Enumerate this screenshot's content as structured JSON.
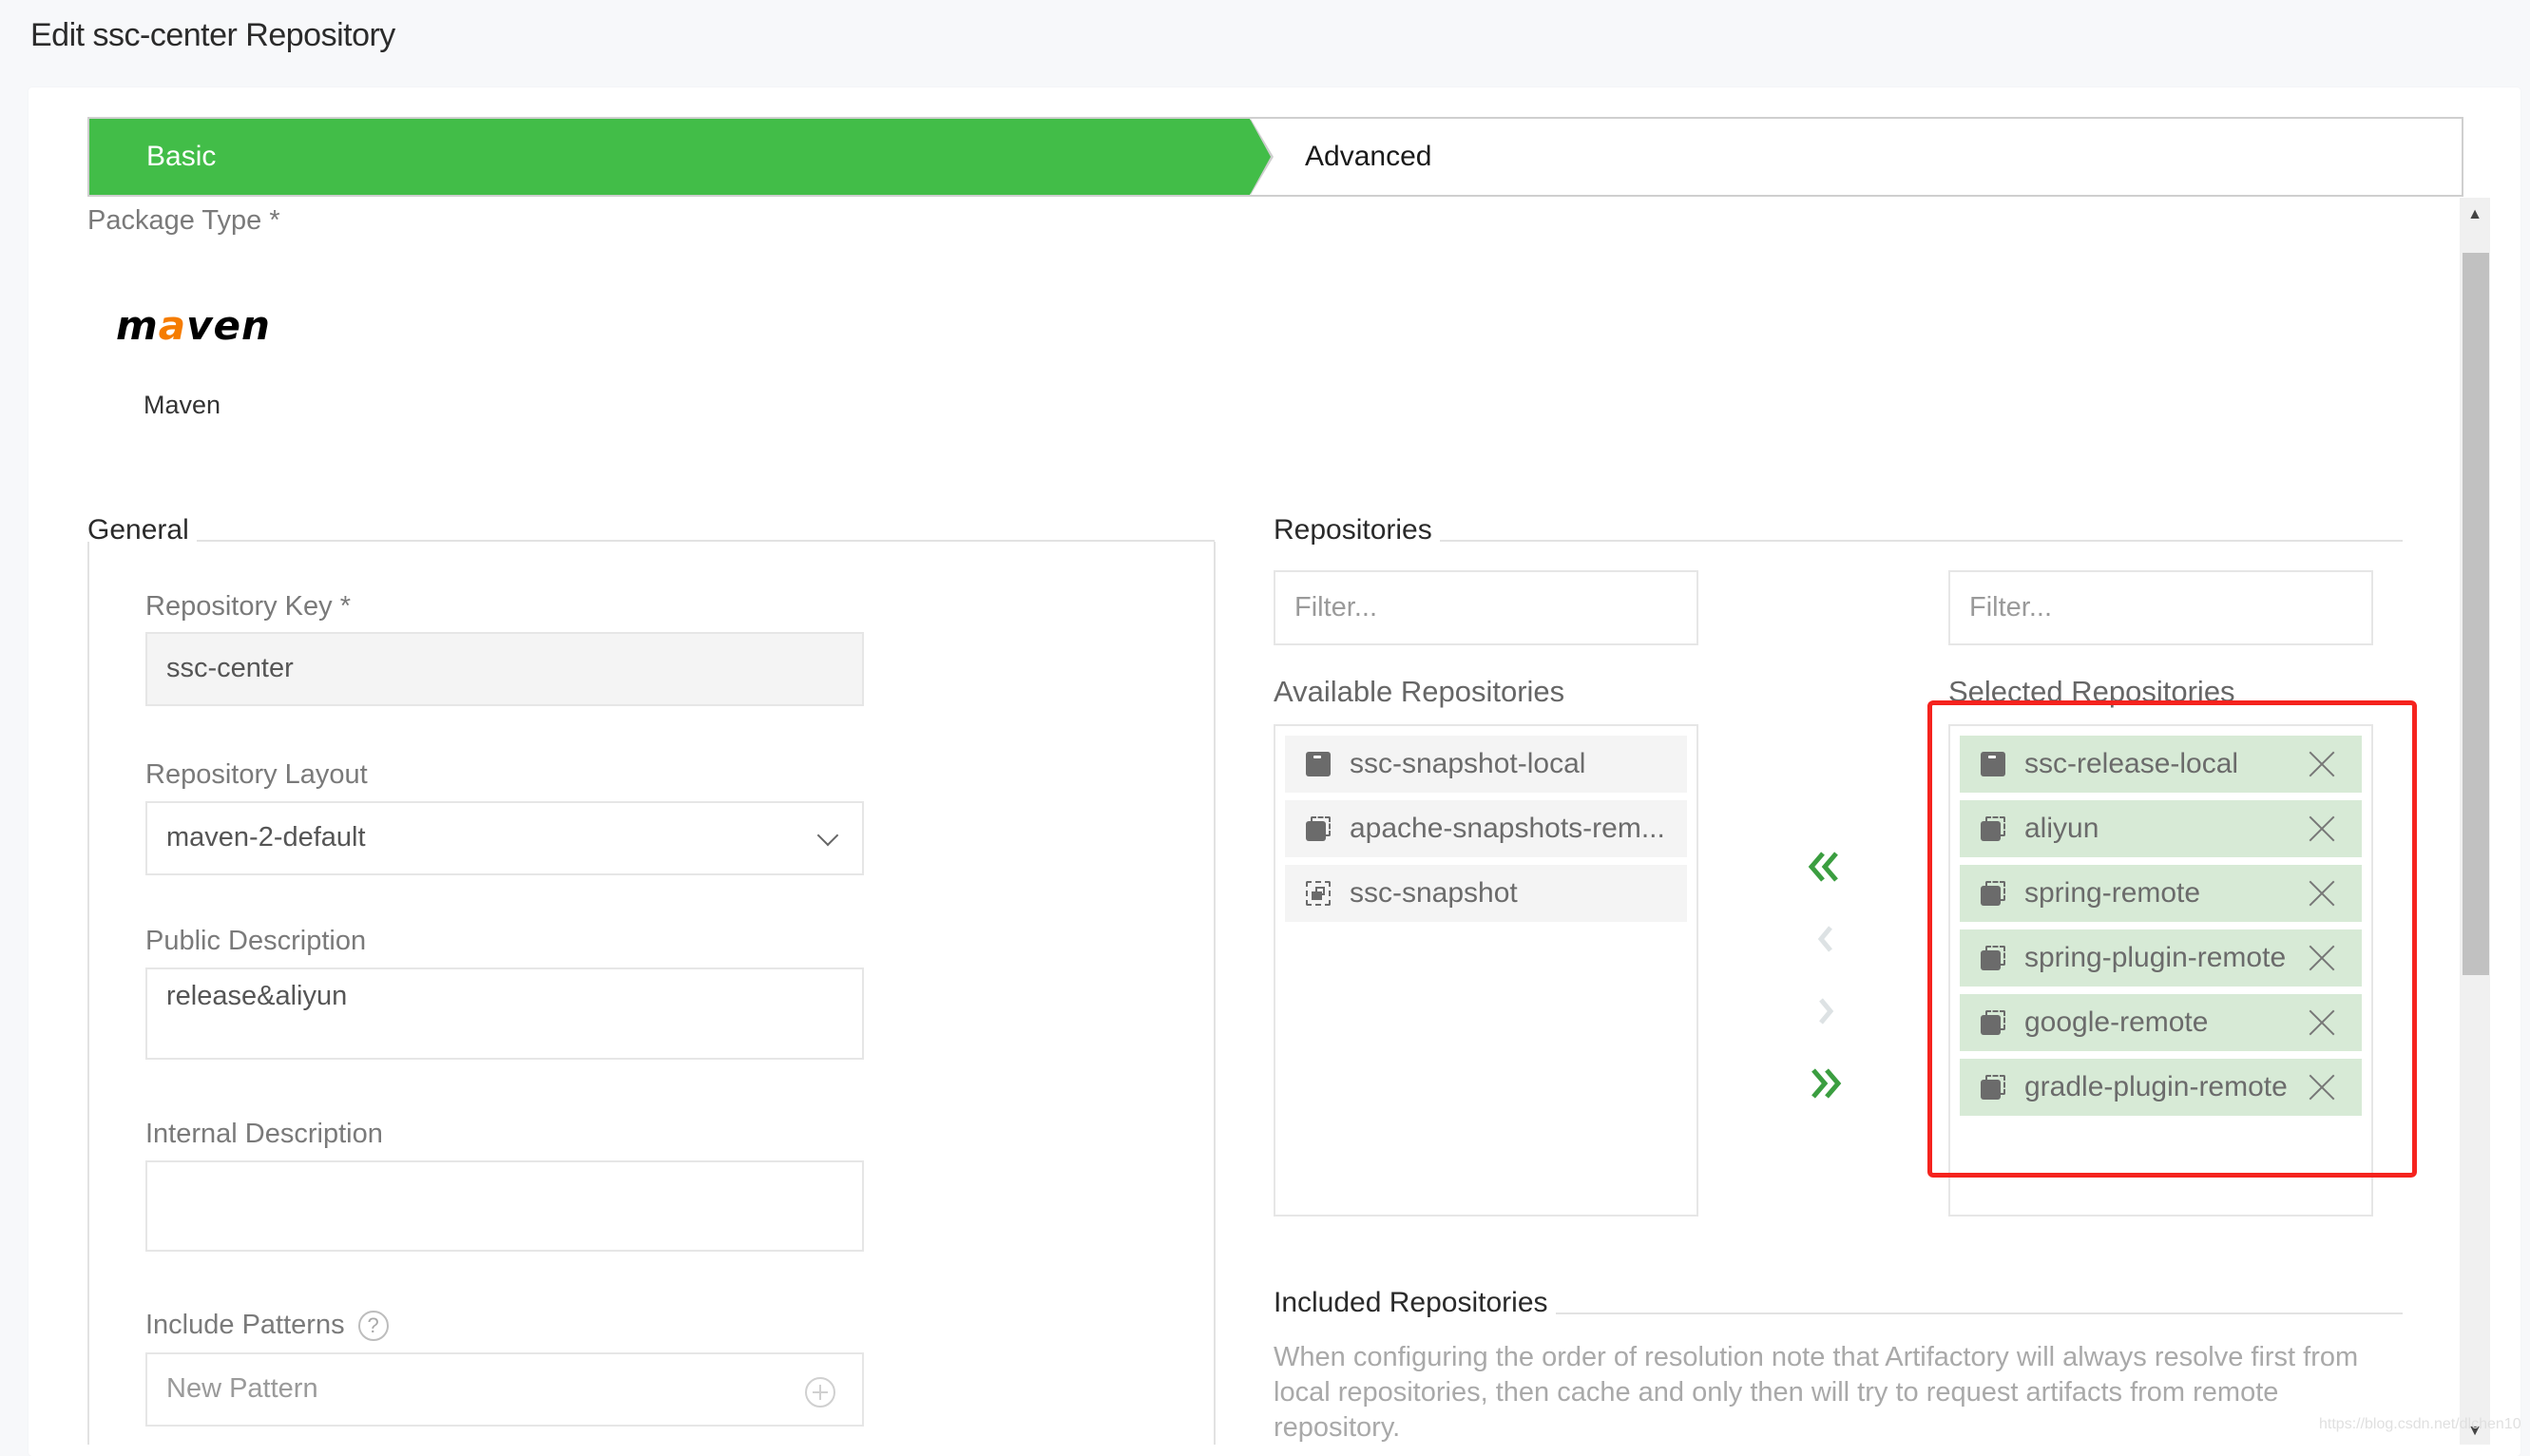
{
  "page": {
    "title": "Edit ssc-center Repository"
  },
  "tabs": [
    {
      "label": "Basic",
      "active": true
    },
    {
      "label": "Advanced",
      "active": false
    }
  ],
  "colors": {
    "active_tab": "#42bd48",
    "selected_item_bg": "#d7ead6",
    "available_item_bg": "#f4f4f4",
    "transfer_arrow_active": "#3b9e40",
    "transfer_arrow_disabled": "#dde2e4",
    "highlight": "#f5231e"
  },
  "package_type": {
    "label": "Package Type *",
    "logo_text_before": "m",
    "logo_text_accent": "a",
    "logo_text_after": "ven",
    "name": "Maven"
  },
  "general": {
    "title": "General",
    "repository_key": {
      "label": "Repository Key *",
      "value": "ssc-center"
    },
    "repository_layout": {
      "label": "Repository Layout",
      "value": "maven-2-default"
    },
    "public_description": {
      "label": "Public Description",
      "value": "release&aliyun"
    },
    "internal_description": {
      "label": "Internal Description",
      "value": ""
    },
    "include_patterns": {
      "label": "Include Patterns",
      "placeholder": "New Pattern",
      "help": "?"
    }
  },
  "repositories": {
    "title": "Repositories",
    "filter_placeholder": "Filter...",
    "available_label": "Available Repositories",
    "selected_label": "Selected Repositories",
    "available": [
      {
        "name": "ssc-snapshot-local",
        "type": "local"
      },
      {
        "name": "apache-snapshots-rem...",
        "type": "remote"
      },
      {
        "name": "ssc-snapshot",
        "type": "virtual"
      }
    ],
    "selected": [
      {
        "name": "ssc-release-local",
        "type": "local"
      },
      {
        "name": "aliyun",
        "type": "remote"
      },
      {
        "name": "spring-remote",
        "type": "remote"
      },
      {
        "name": "spring-plugin-remote",
        "type": "remote"
      },
      {
        "name": "google-remote",
        "type": "remote"
      },
      {
        "name": "gradle-plugin-remote",
        "type": "remote"
      }
    ],
    "transfer_buttons": [
      {
        "name": "move-all-left",
        "enabled": true
      },
      {
        "name": "move-left",
        "enabled": false
      },
      {
        "name": "move-right",
        "enabled": false
      },
      {
        "name": "move-all-right",
        "enabled": true
      }
    ]
  },
  "included_repositories": {
    "title": "Included Repositories",
    "description": "When configuring the order of resolution note that Artifactory will always resolve first from local repositories, then cache and only then will try to request artifacts from remote repository."
  },
  "watermark": "https://blog.csdn.net/dlchen10"
}
